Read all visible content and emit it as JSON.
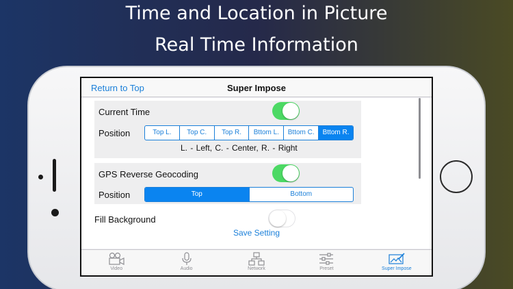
{
  "promo": {
    "line1": "Time and Location in Picture",
    "line2": "Real Time Information"
  },
  "navbar": {
    "back_label": "Return to Top",
    "title": "Super Impose"
  },
  "current_time": {
    "label": "Current Time",
    "toggle_on": true,
    "position_label": "Position",
    "positions": [
      "Top L.",
      "Top C.",
      "Top R.",
      "Bttom L.",
      "Bttom C.",
      "Bttom R."
    ],
    "selected_position": "Bttom R.",
    "legend": "L. - Left,   C. - Center,   R. - Right"
  },
  "gps": {
    "label": "GPS Reverse Geocoding",
    "toggle_on": true,
    "position_label": "Position",
    "positions": [
      "Top",
      "Bottom"
    ],
    "selected_position": "Top"
  },
  "fill_background": {
    "label": "Fill Background",
    "toggle_on": false
  },
  "save_label": "Save Setting",
  "tabbar": {
    "tabs": [
      {
        "label": "Video",
        "icon": "video-camera-icon"
      },
      {
        "label": "Audio",
        "icon": "microphone-icon"
      },
      {
        "label": "Network",
        "icon": "network-icon"
      },
      {
        "label": "Preset",
        "icon": "sliders-icon"
      },
      {
        "label": "Super Impose",
        "icon": "image-pen-icon"
      }
    ],
    "active": "Super Impose"
  },
  "colors": {
    "accent": "#1a7fd9",
    "toggle_on": "#4cd964",
    "segment_selected": "#0a84f0"
  }
}
